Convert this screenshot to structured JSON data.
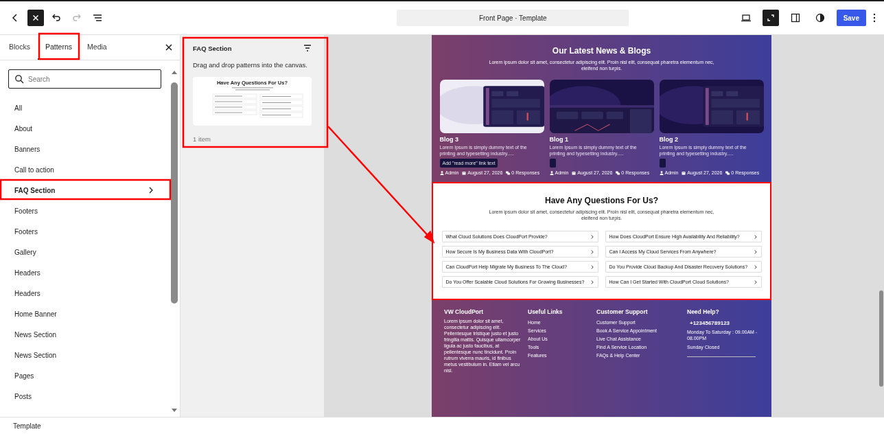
{
  "toolbar": {
    "document_title": "Front Page · Template",
    "save": "Save"
  },
  "sidebar": {
    "tabs": [
      {
        "label": "Blocks",
        "selected": false
      },
      {
        "label": "Patterns",
        "selected": true
      },
      {
        "label": "Media",
        "selected": false
      }
    ],
    "search": {
      "placeholder": "Search"
    },
    "categories": [
      {
        "label": "All",
        "selected": false
      },
      {
        "label": "About",
        "selected": false
      },
      {
        "label": "Banners",
        "selected": false
      },
      {
        "label": "Call to action",
        "selected": false
      },
      {
        "label": "FAQ Section",
        "selected": true
      },
      {
        "label": "Footers",
        "selected": false
      },
      {
        "label": "Footers",
        "selected": false
      },
      {
        "label": "Gallery",
        "selected": false
      },
      {
        "label": "Headers",
        "selected": false
      },
      {
        "label": "Headers",
        "selected": false
      },
      {
        "label": "Home Banner",
        "selected": false
      },
      {
        "label": "News Section",
        "selected": false
      },
      {
        "label": "News Section",
        "selected": false
      },
      {
        "label": "Pages",
        "selected": false
      },
      {
        "label": "Posts",
        "selected": false
      }
    ]
  },
  "pattern_panel": {
    "title": "FAQ Section",
    "hint": "Drag and drop patterns into the canvas.",
    "preview_title": "Have Any Questions For Us?",
    "count": "1 item"
  },
  "canvas": {
    "blogs": {
      "title": "Our Latest News & Blogs",
      "intro": "Lorem ipsum dolor sit amet, consectetur adipiscing elit. Proin nisl elit, consequat pharetra elementum nec, eleifend non turpis.",
      "posts": [
        {
          "title": "Blog 3",
          "excerpt": "Lorem Ipsum is simply dummy text of the printing and typesetting industry.....",
          "read_more": "Add \"read more\" link text",
          "author": "Admin",
          "date": "August 27, 2026",
          "responses": "0 Responses"
        },
        {
          "title": "Blog 1",
          "excerpt": "Lorem Ipsum is simply dummy text of the printing and typesetting industry.....",
          "author": "Admin",
          "date": "August 27, 2026",
          "responses": "0 Responses"
        },
        {
          "title": "Blog 2",
          "excerpt": "Lorem Ipsum is simply dummy text of the printing and typesetting industry.....",
          "author": "Admin",
          "date": "August 27, 2026",
          "responses": "0 Responses"
        }
      ]
    },
    "faq": {
      "title": "Have Any Questions For Us?",
      "intro": "Lorem ipsum dolor sit amet, consectetur adipiscing elit. Proin nisl elit, consequat pharetra elementum nec, eleifend non turpis.",
      "questions": [
        "What Cloud Solutions Does CloudPort Provide?",
        "How Does CloudPort Ensure High Availability And Reliability?",
        "How Secure Is My Business Data With CloudPort?",
        "Can I Access My Cloud Services From Anywhere?",
        "Can CloudPort Help Migrate My Business To The Cloud?",
        "Do You Provide Cloud Backup And Disaster Recovery Solutions?",
        "Do You Offer Scalable Cloud Solutions For Growing Businesses?",
        "How Can I Get Started With CloudPort Cloud Solutions?"
      ]
    },
    "footer": {
      "brand": {
        "title": "VW CloudPort",
        "text": "Lorem ipsum dolor sit amet, consectetur adipiscing elit. Pellentesque tristique justo et justo fringilla mattis. Quisque ullamcorper ligula ac justo faucibus, at pellentesque nunc tincidunt. Proin rutrum viverra mauris, id finibus metus vestibulum in. Etiam vel arcu nisl."
      },
      "useful_links": {
        "title": "Useful Links",
        "items": [
          "Home",
          "Services",
          "About Us",
          "Tools",
          "Features"
        ]
      },
      "customer_support": {
        "title": "Customer Support",
        "items": [
          "Customer Support",
          "Book A Service Appointment",
          "Live Chat Assistance",
          "Find A Service Location",
          "FAQs & Help Center"
        ]
      },
      "help": {
        "title": "Need Help?",
        "phone": "+123456789123",
        "hours": "Monday To Saturday : 09.00AM - 08.00PM",
        "closed": "Sunday Closed"
      }
    }
  },
  "status_bar": "Template"
}
